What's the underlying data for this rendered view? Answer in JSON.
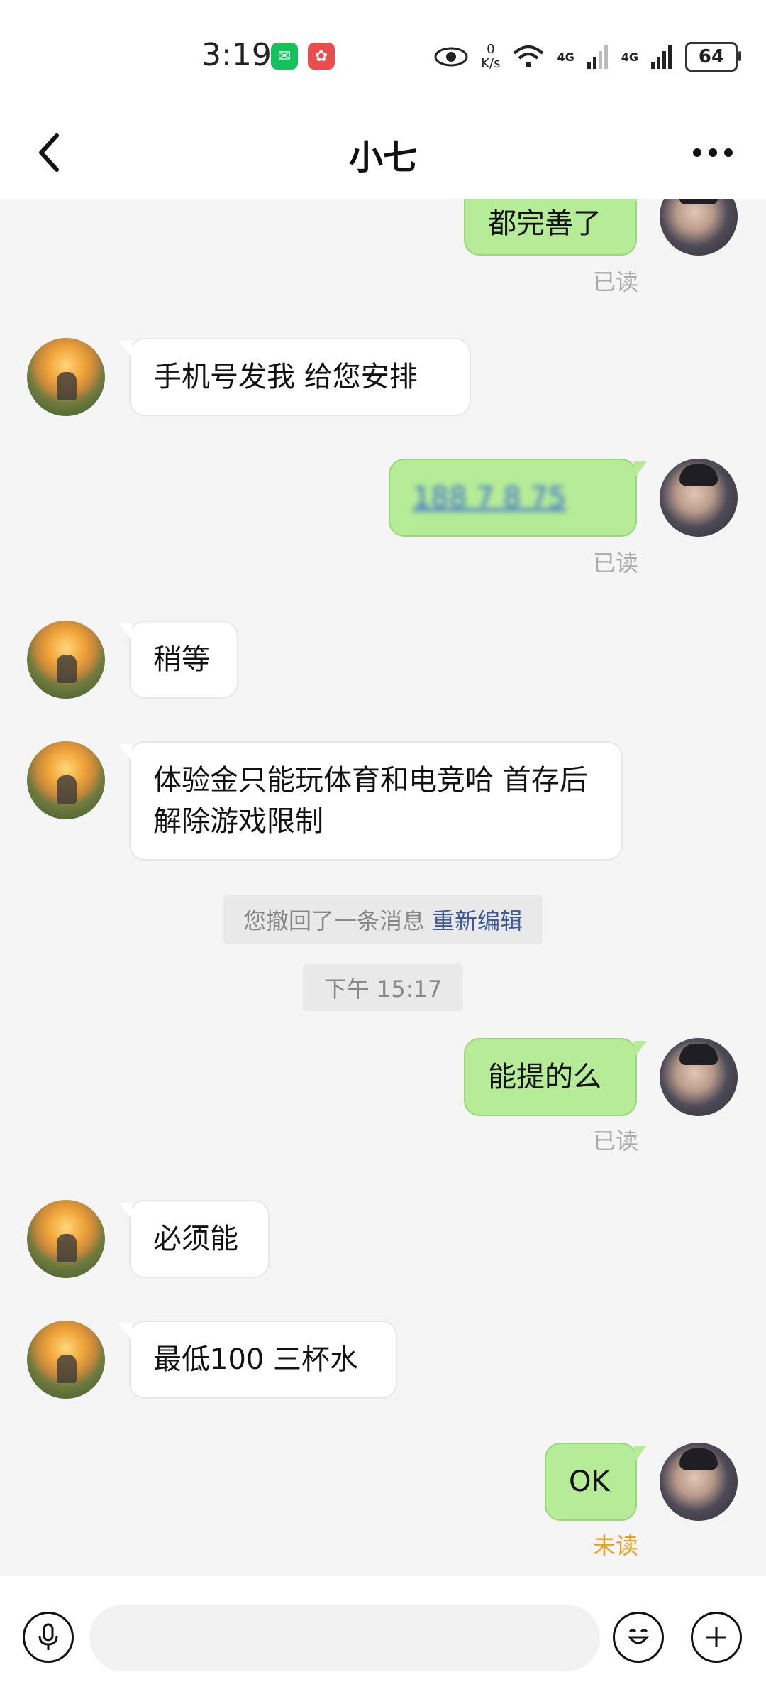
{
  "status_bar": {
    "time": "3:19",
    "net_speed_value": "0",
    "net_speed_unit": "K/s",
    "signal_1": "4G",
    "signal_2": "4G",
    "battery": "64"
  },
  "header": {
    "title": "小七"
  },
  "messages": [
    {
      "side": "out",
      "text": "都完善了",
      "read": "已读"
    },
    {
      "side": "in",
      "text": "手机号发我 给您安排"
    },
    {
      "side": "out",
      "text": "188 7 8 75",
      "read": "已读"
    },
    {
      "side": "in",
      "text": "稍等"
    },
    {
      "side": "in",
      "text": "体验金只能玩体育和电竞哈 首存后解除游戏限制"
    },
    {
      "side": "system",
      "text": "您撤回了一条消息",
      "link": "重新编辑"
    },
    {
      "side": "time",
      "text": "下午 15:17"
    },
    {
      "side": "out",
      "text": "能提的么",
      "read": "已读"
    },
    {
      "side": "in",
      "text": "必须能"
    },
    {
      "side": "in",
      "text": "最低100 三杯水"
    },
    {
      "side": "out",
      "text": "OK",
      "read": "未读"
    }
  ],
  "input": {
    "placeholder": ""
  },
  "colors": {
    "outgoing_bubble": "#b6ec97",
    "incoming_bubble": "#ffffff",
    "unread": "#e6a01f",
    "link": "#3e5a9a"
  }
}
